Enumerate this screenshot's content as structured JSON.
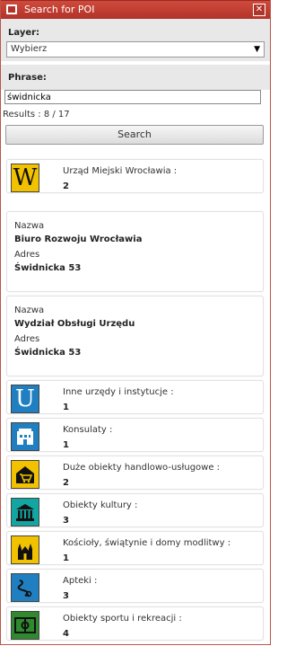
{
  "window": {
    "title": "Search for POI"
  },
  "form": {
    "layer_label": "Layer:",
    "layer_value": "Wybierz",
    "phrase_label": "Phrase:",
    "phrase_value": "świdnicka",
    "results_text": "Results : 8 / 17",
    "search_button": "Search"
  },
  "categories": [
    {
      "name": "Urząd Miejski Wrocławia :",
      "count": "2",
      "icon": "letter-w-icon",
      "color": "#f2c200"
    },
    {
      "name": "Inne urzędy i instytucje :",
      "count": "1",
      "icon": "letter-u-icon",
      "color": "#1f7fc1"
    },
    {
      "name": "Konsulaty :",
      "count": "1",
      "icon": "consulate-building-icon",
      "color": "#1f7fc1"
    },
    {
      "name": "Duże obiekty handlowo-usługowe :",
      "count": "2",
      "icon": "shopping-cart-icon",
      "color": "#f2c200"
    },
    {
      "name": "Obiekty kultury :",
      "count": "3",
      "icon": "museum-icon",
      "color": "#13a5a2"
    },
    {
      "name": "Kościoły, świątynie i domy modlitwy :",
      "count": "1",
      "icon": "church-icon",
      "color": "#f2c200"
    },
    {
      "name": "Apteki :",
      "count": "3",
      "icon": "pharmacy-snake-icon",
      "color": "#1f7fc1"
    },
    {
      "name": "Obiekty sportu i rekreacji :",
      "count": "4",
      "icon": "sports-field-icon",
      "color": "#2f8a2f"
    }
  ],
  "details": [
    {
      "name_label": "Nazwa",
      "name": "Biuro Rozwoju Wrocławia",
      "addr_label": "Adres",
      "address": "Świdnicka 53"
    },
    {
      "name_label": "Nazwa",
      "name": "Wydział Obsługi Urzędu",
      "addr_label": "Adres",
      "address": "Świdnicka 53"
    }
  ]
}
